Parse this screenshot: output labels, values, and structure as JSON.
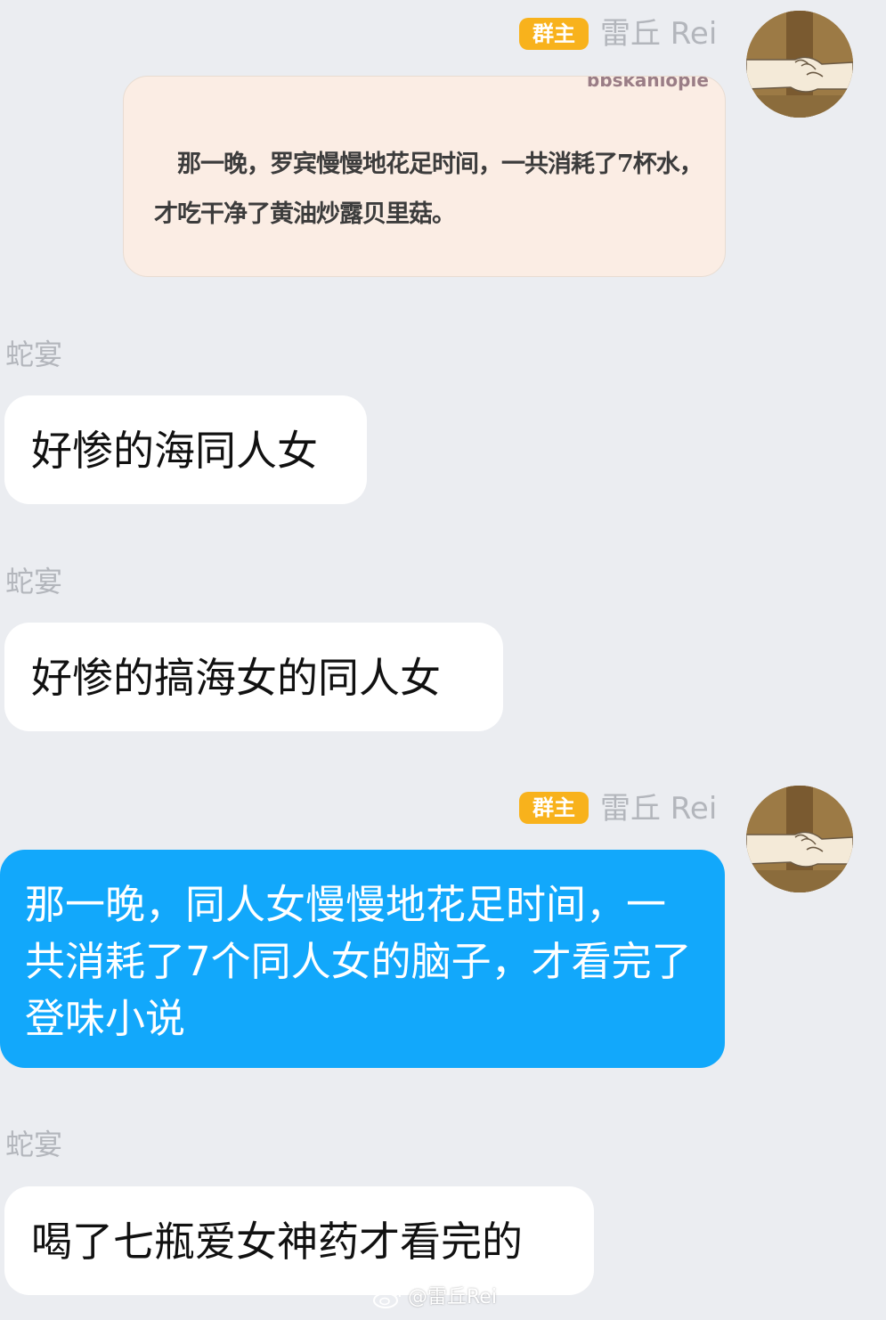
{
  "messages": [
    {
      "sender": "雷丘 Rei",
      "badge": "群主",
      "image_text_top": "bbskanlopie",
      "image_line1": "那一晚，罗宾慢慢地花足时间，一共消耗了7杯水，",
      "image_line2": "才吃干净了黄油炒露贝里菇。"
    },
    {
      "sender": "蛇宴",
      "text": "好惨的海同人女"
    },
    {
      "sender": "蛇宴",
      "text": "好惨的搞海女的同人女"
    },
    {
      "sender": "雷丘 Rei",
      "badge": "群主",
      "text": "那一晚，同人女慢慢地花足时间，一共消耗了7个同人女的脑子，才看完了登味小说"
    },
    {
      "sender": "蛇宴",
      "text": "喝了七瓶爱女神药才看完的"
    }
  ],
  "watermark": "@雷丘Rei",
  "colors": {
    "background": "#ebedf1",
    "badge": "#f8b21c",
    "blue_bubble": "#12a8fb",
    "white_bubble": "#ffffff",
    "image_bg": "#fbede4"
  }
}
